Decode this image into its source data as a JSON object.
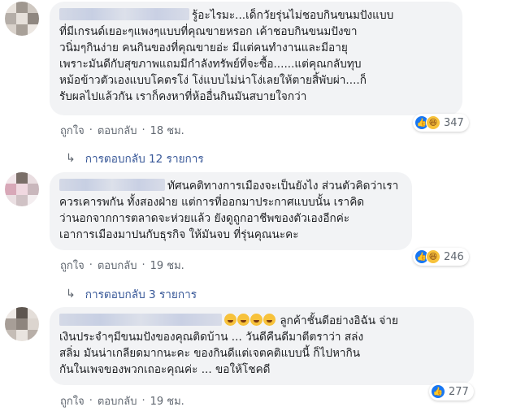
{
  "comments": [
    {
      "lines": [
        "รู้อะไรมะ...เด็กวัยรุ่นไม่ชอบกินขนมปังแบบ",
        "ที่มีเกรนด์เยอะๆแพงๆแบบที่คุณขายหรอก เค้าชอบกินขนมปังขา",
        "วนิ่มๆกินง่าย คนกินของที่คุณขายอ่ะ มีแต่คนทำงานและมีอายุ",
        "เพราะมันดีกับสุขภาพแถมมีกำลังทรัพย์ที่จะซื้อ......แต่คุณกลับทุบ",
        "หม้อข้าวตัวเองแบบโคตรโง่ โง่แบบไม่น่าโง่เลยให้ตายสิ้พับผ่า....ก็",
        "รับผลไปแล้วกัน เราก็คงหาที่ห้ออื่นกินมันสบายใจกว่า"
      ],
      "reaction_count": "347",
      "like": "ถูกใจ",
      "reply": "ตอบกลับ",
      "time": "18 ชม.",
      "replies_label": "การตอบกลับ 12 รายการ"
    },
    {
      "lines": [
        "ทัศนคติทางการเมืองจะเป็นยังไง ส่วนตัวคิดว่าเรา",
        "ควรเคารพกัน ทั้งสองฝ่าย แต่การที่ออกมาประกาศแบบนั้น เราคิด",
        "ว่านอกจากการตลาดจะห่วยแล้ว ยังดูถูกอาชีพของตัวเองอีกค่ะ",
        "เอาการเมืองมาปนกับธุรกิจ ให้มันจบ ที่รุ่นคุณนะคะ"
      ],
      "reaction_count": "246",
      "like": "ถูกใจ",
      "reply": "ตอบกลับ",
      "time": "19 ชม.",
      "replies_label": "การตอบกลับ 3 รายการ"
    },
    {
      "lines": [
        "ลูกค้าชั้นดีอย่างอิฉัน จ่าย",
        "เงินประจำๆมีขนมปังของคุณติดบ้าน ... วันดีคืนดีมาตีตราว่า สล่ง",
        "สลิ่ม มันน่าเกลียดมากนะคะ ของกินดีแต่เจตคติแบบนี้ ก็ไปหากิน",
        "กันในเพจของพวกเถอะคุณค่ะ ... ขอให้โชคดี"
      ],
      "reaction_count": "277",
      "like": "ถูกใจ",
      "reply": "ตอบกลับ",
      "time": "19 ชม."
    }
  ],
  "colors": {
    "bubble": "#f2f3f5",
    "link": "#385898",
    "meta": "#606770",
    "like_blue": "#1877f2",
    "haha_yellow": "#f7c23b"
  },
  "icons": [
    "like-icon",
    "haha-icon",
    "reply-arrow-icon",
    "laughing-emoji-icon"
  ]
}
